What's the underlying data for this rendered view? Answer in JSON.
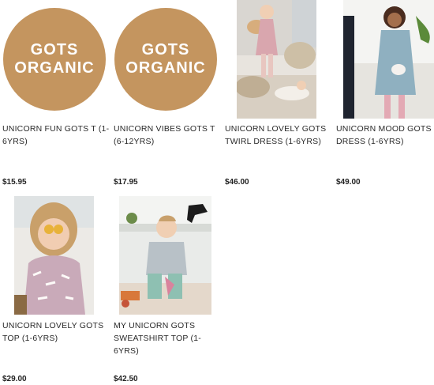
{
  "colors": {
    "badge": "#c4955f",
    "price": "#222222"
  },
  "products": [
    {
      "title": "UNICORN FUN GOTS T (1-6YRS)",
      "price": "$15.95",
      "image": "gots-organic-badge",
      "badge_line1": "GOTS",
      "badge_line2": "ORGANIC"
    },
    {
      "title": "UNICORN VIBES GOTS T (6-12YRS)",
      "price": "$17.95",
      "image": "gots-organic-badge",
      "badge_line1": "GOTS",
      "badge_line2": "ORGANIC"
    },
    {
      "title": "UNICORN LOVELY GOTS TWIRL DRESS (1-6YRS)",
      "price": "$46.00",
      "image": "girl-pink-dress-photo"
    },
    {
      "title": "UNICORN MOOD GOTS DRESS (1-6YRS)",
      "price": "$49.00",
      "image": "girl-blue-dress-photo"
    },
    {
      "title": "UNICORN LOVELY GOTS TOP (1-6YRS)",
      "price": "$29.00",
      "image": "girl-pink-top-photo"
    },
    {
      "title": "MY UNICORN GOTS SWEATSHIRT TOP (1-6YRS)",
      "price": "$42.50",
      "image": "girl-grey-sweatshirt-photo"
    }
  ]
}
